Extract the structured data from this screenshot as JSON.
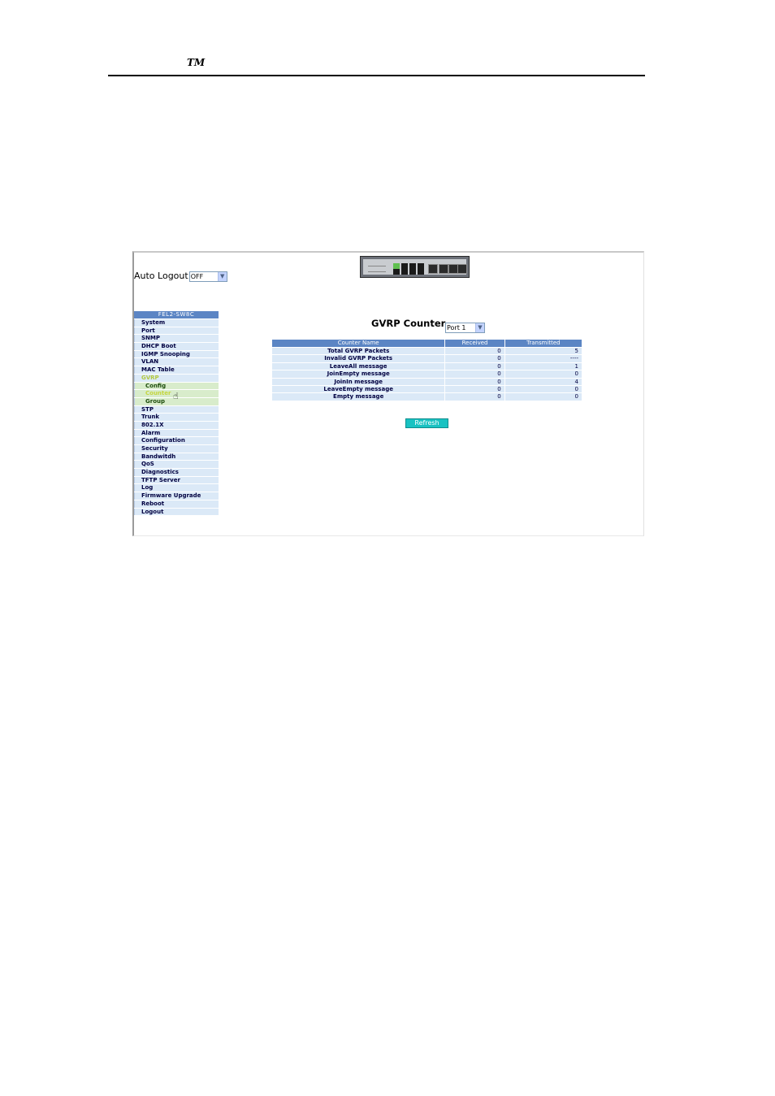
{
  "header": {
    "tm": "TM"
  },
  "auto_logout": {
    "label": "Auto Logout",
    "value": "OFF"
  },
  "nav": {
    "title": "FEL2-SW8C",
    "items": [
      {
        "label": "System",
        "kind": "item"
      },
      {
        "label": "Port",
        "kind": "item"
      },
      {
        "label": "SNMP",
        "kind": "item"
      },
      {
        "label": "DHCP Boot",
        "kind": "item"
      },
      {
        "label": "IGMP Snooping",
        "kind": "item"
      },
      {
        "label": "VLAN",
        "kind": "item"
      },
      {
        "label": "MAC Table",
        "kind": "item"
      },
      {
        "label": "GVRP",
        "kind": "item"
      },
      {
        "label": "Config",
        "kind": "sub"
      },
      {
        "label": "Counter",
        "kind": "sub"
      },
      {
        "label": "Group",
        "kind": "sub"
      },
      {
        "label": "STP",
        "kind": "item"
      },
      {
        "label": "Trunk",
        "kind": "item"
      },
      {
        "label": "802.1X",
        "kind": "item"
      },
      {
        "label": "Alarm",
        "kind": "item"
      },
      {
        "label": "Configuration",
        "kind": "item"
      },
      {
        "label": "Security",
        "kind": "item"
      },
      {
        "label": "Bandwitdh",
        "kind": "item"
      },
      {
        "label": "QoS",
        "kind": "item"
      },
      {
        "label": "Diagnostics",
        "kind": "item"
      },
      {
        "label": "TFTP Server",
        "kind": "item"
      },
      {
        "label": "Log",
        "kind": "item"
      },
      {
        "label": "Firmware Upgrade",
        "kind": "item"
      },
      {
        "label": "Reboot",
        "kind": "item"
      },
      {
        "label": "Logout",
        "kind": "item"
      }
    ],
    "active": "Counter"
  },
  "page": {
    "title": "GVRP Counter",
    "port_select": "Port 1"
  },
  "table": {
    "headers": [
      "Counter Name",
      "Received",
      "Transmitted"
    ],
    "rows": [
      [
        "Total GVRP Packets",
        "0",
        "5"
      ],
      [
        "Invalid GVRP Packets",
        "0",
        "----"
      ],
      [
        "LeaveAll message",
        "0",
        "1"
      ],
      [
        "JoinEmpty message",
        "0",
        "0"
      ],
      [
        "JoinIn message",
        "0",
        "4"
      ],
      [
        "LeaveEmpty message",
        "0",
        "0"
      ],
      [
        "Empty message",
        "0",
        "0"
      ]
    ]
  },
  "refresh_label": "Refresh",
  "icons": {
    "dropdown": "chevron-down-icon",
    "cursor": "hand-pointer-icon",
    "device": "switch-front-panel-image"
  }
}
